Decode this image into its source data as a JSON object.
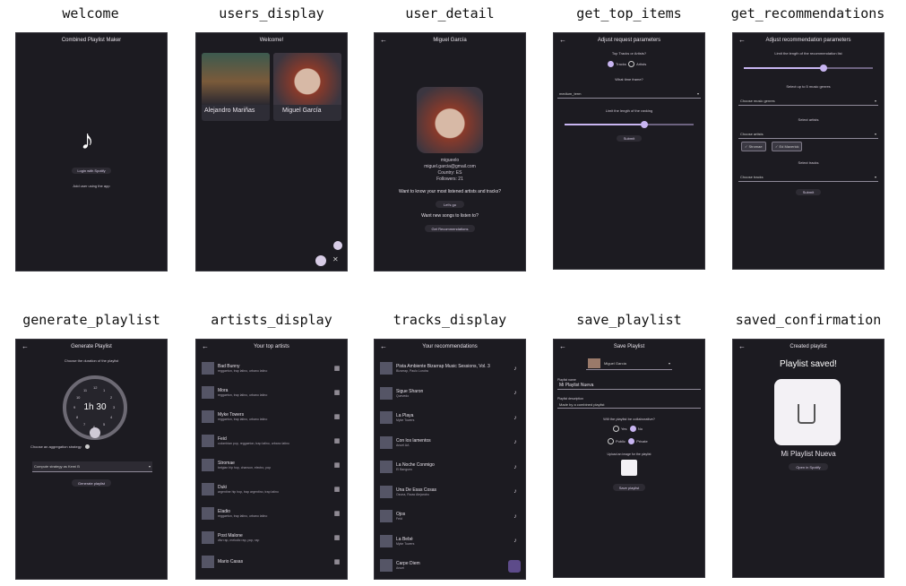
{
  "captions": [
    "welcome",
    "users_display",
    "user_detail",
    "get_top_items",
    "get_recommendations",
    "generate_playlist",
    "artists_display",
    "tracks_display",
    "save_playlist",
    "saved_confirmation"
  ],
  "welcome": {
    "title": "Combined Playlist Maker",
    "login": "Login with Spotify",
    "continue": "Add user using the app"
  },
  "users_display": {
    "title": "Welcome!",
    "users": [
      {
        "name": "Alejandro Mariñas"
      },
      {
        "name": "Miguel García"
      }
    ]
  },
  "user_detail": {
    "title": "Miguel García",
    "username": "migueelo",
    "email": "miguel.garcia@gmail.com",
    "country": "Country: ES",
    "followers": "Followers: 21",
    "q1": "Want to know your most listened artists and tracks?",
    "b1": "Let's go",
    "q2": "Want new songs to listen to?",
    "b2": "Get Recommendations"
  },
  "get_top_items": {
    "title": "Adjust request parameters",
    "q": "Top Tracks or Artists?",
    "opt1": "Tracks",
    "opt2": "Artists",
    "q2": "What time frame?",
    "dd": "medium_term",
    "limit": "Limit the length of the ranking",
    "submit": "Submit",
    "limit_value": 0.62
  },
  "get_recommendations": {
    "title": "Adjust recommendation parameters",
    "limit": "Limit the length of the recommendation list",
    "limit_value": 0.62,
    "genres_label": "Select up to 5 music genres",
    "genres_dd": "Choose music genres",
    "artists_label": "Select artists",
    "artists_dd": "Choose artists",
    "chips": [
      "Stromae",
      "Ed Maverick"
    ],
    "tracks_label": "Select tracks",
    "tracks_dd": "Choose tracks",
    "submit": "Submit"
  },
  "generate_playlist": {
    "title": "Generate Playlist",
    "q": "Choose the duration of the playlist",
    "dial": "1h 30",
    "strategy_label": "Choose an aggregation strategy",
    "strategy": "Compute strategy as Kemi B",
    "button": "Generate playlist",
    "dial_labels": [
      "1",
      "2",
      "3",
      "4",
      "5",
      "6",
      "7",
      "8",
      "9",
      "10",
      "11",
      "12"
    ]
  },
  "artists_display": {
    "title": "Your top artists",
    "items": [
      {
        "name": "Bad Bunny",
        "genres": "reggaeton, trap latino, urbano latino"
      },
      {
        "name": "Mora",
        "genres": "reggaeton, trap latino, urbano latino"
      },
      {
        "name": "Myke Towers",
        "genres": "reggaeton, trap latino, urbano latino"
      },
      {
        "name": "Feid",
        "genres": "colombian pop, reggaeton, trap latino, urbano latino"
      },
      {
        "name": "Stromae",
        "genres": "belgian hip hop, chanson, electro, pop"
      },
      {
        "name": "Duki",
        "genres": "argentine hip hop, trap argentino, trap latino"
      },
      {
        "name": "Eladio",
        "genres": "reggaeton, trap latino, urbano latino"
      },
      {
        "name": "Post Malone",
        "genres": "dfw rap, melodic rap, pop, rap"
      },
      {
        "name": "Mario Casas",
        "genres": ""
      }
    ]
  },
  "tracks_display": {
    "title": "Your recommendations",
    "items": [
      {
        "name": "Pista Ambiente Bizarrap Music Sessions, Vol. 3",
        "artist": "Bizarrap, Paulo Londra"
      },
      {
        "name": "Sigue Sharon",
        "artist": "Quevedo"
      },
      {
        "name": "La Playa",
        "artist": "Myke Towers"
      },
      {
        "name": "Con los lamentos",
        "artist": "Anuel AA"
      },
      {
        "name": "La Noche Conmigo",
        "artist": "El Bangueo"
      },
      {
        "name": "Una De Esas Cosas",
        "artist": "Ozuna, Rauw Alejandro"
      },
      {
        "name": "Ojos",
        "artist": "Feid"
      },
      {
        "name": "La Bebé",
        "artist": "Myke Towers"
      },
      {
        "name": "Carpe Diem",
        "artist": "Anuel"
      }
    ]
  },
  "save_playlist": {
    "title": "Save Playlist",
    "user": "Miguel García",
    "name_label": "Playlist name",
    "name": "Mi Playlist Nueva",
    "desc_label": "Playlist description",
    "desc": "Made by a combined playlist",
    "q_collab": "Will the playlist be collaborative?",
    "yes": "Yes",
    "no": "No",
    "public": "Public",
    "private": "Private",
    "image_label": "Upload an image for the playlist",
    "save": "Save playlist"
  },
  "saved_confirmation": {
    "title": "Created playlist",
    "heading": "Playlist saved!",
    "name": "Mi Playlist Nueva",
    "open": "Open in Spotify"
  }
}
